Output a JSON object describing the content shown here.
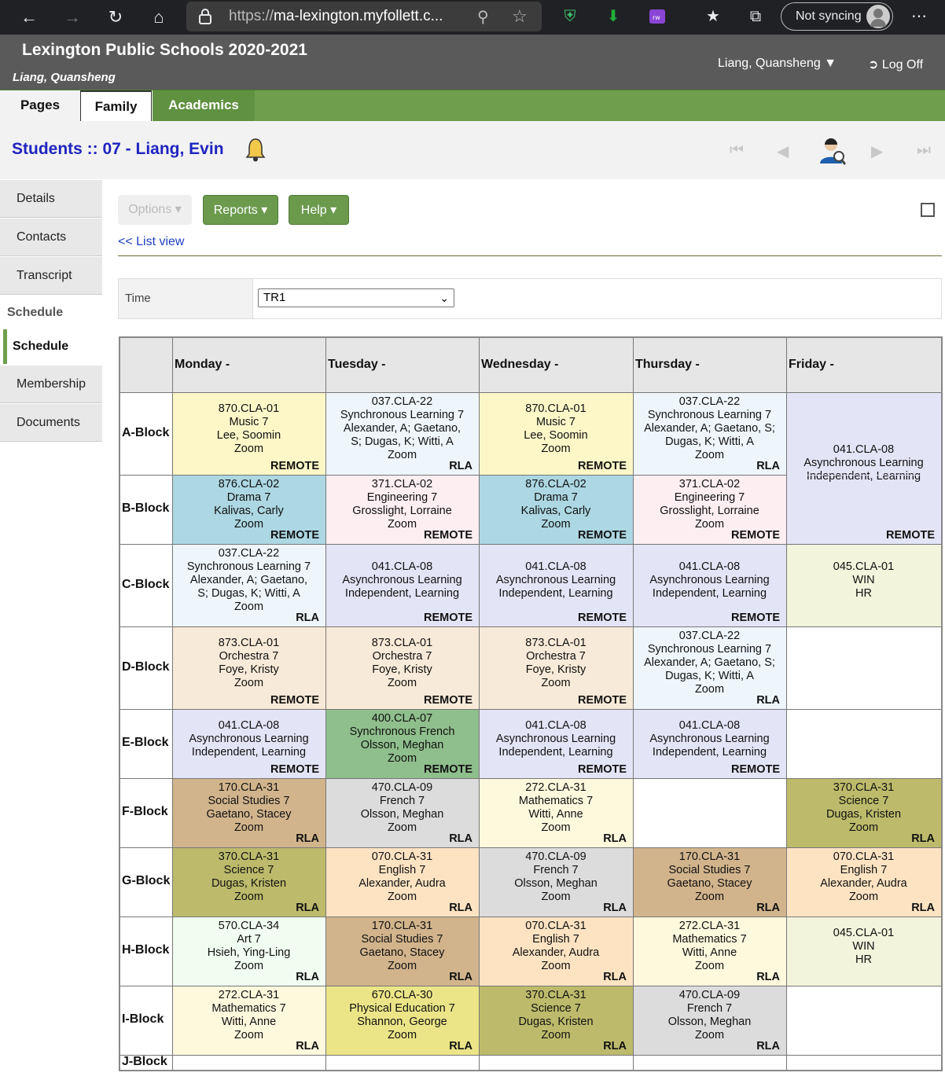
{
  "browser": {
    "url_scheme": "https://",
    "url_host": "ma-lexington.myfollett.c...",
    "sync_label": "Not syncing"
  },
  "header": {
    "school": "Lexington Public Schools 2020-2021",
    "user_italic": "Liang, Quansheng",
    "user_menu": "Liang, Quansheng ▼",
    "logoff": "Log Off"
  },
  "tabs": [
    "Pages",
    "Family",
    "Academics"
  ],
  "title": "Students :: 07 - Liang, Evin",
  "sidenav": {
    "items_top": [
      "Details",
      "Contacts",
      "Transcript"
    ],
    "section": "Schedule",
    "active": "Schedule",
    "items_bottom": [
      "Membership",
      "Documents"
    ]
  },
  "toolbar": {
    "options": "Options",
    "reports": "Reports",
    "help": "Help"
  },
  "list_view": "<< List view",
  "time": {
    "label": "Time",
    "value": "TR1"
  },
  "schedule": {
    "days": [
      "Monday -",
      "Tuesday -",
      "Wednesday -",
      "Thursday -",
      "Friday -"
    ],
    "blocks": [
      "A-Block",
      "B-Block",
      "C-Block",
      "D-Block",
      "E-Block",
      "F-Block",
      "G-Block",
      "H-Block",
      "I-Block",
      "J-Block"
    ],
    "cells": [
      {
        "b": 0,
        "d": 0,
        "lines": [
          "870.CLA-01",
          "Music 7",
          "Lee, Soomin",
          "Zoom"
        ],
        "tag": "REMOTE",
        "color": "#fdf7c8"
      },
      {
        "b": 0,
        "d": 1,
        "lines": [
          "037.CLA-22",
          "Synchronous Learning 7",
          "Alexander, A; Gaetano,",
          "S; Dugas, K; Witti, A",
          "Zoom"
        ],
        "tag": "RLA",
        "color": "#eef6fc"
      },
      {
        "b": 0,
        "d": 2,
        "lines": [
          "870.CLA-01",
          "Music 7",
          "Lee, Soomin",
          "Zoom"
        ],
        "tag": "REMOTE",
        "color": "#fdf7c8"
      },
      {
        "b": 0,
        "d": 3,
        "lines": [
          "037.CLA-22",
          "Synchronous Learning 7",
          "Alexander, A; Gaetano, S;",
          "Dugas, K; Witti, A",
          "Zoom"
        ],
        "tag": "RLA",
        "color": "#eef6fc"
      },
      {
        "b": 0,
        "d": 4,
        "span": 2,
        "lines": [
          "041.CLA-08",
          "Asynchronous Learning",
          "Independent, Learning"
        ],
        "tag": "REMOTE",
        "color": "#e4e4f7"
      },
      {
        "b": 1,
        "d": 0,
        "lines": [
          "876.CLA-02",
          "Drama 7",
          "Kalivas, Carly",
          "Zoom"
        ],
        "tag": "REMOTE",
        "color": "#acd7e3"
      },
      {
        "b": 1,
        "d": 1,
        "lines": [
          "371.CLA-02",
          "Engineering 7",
          "Grosslight, Lorraine",
          "Zoom"
        ],
        "tag": "REMOTE",
        "color": "#fdeef2"
      },
      {
        "b": 1,
        "d": 2,
        "lines": [
          "876.CLA-02",
          "Drama 7",
          "Kalivas, Carly",
          "Zoom"
        ],
        "tag": "REMOTE",
        "color": "#acd7e3"
      },
      {
        "b": 1,
        "d": 3,
        "lines": [
          "371.CLA-02",
          "Engineering 7",
          "Grosslight, Lorraine",
          "Zoom"
        ],
        "tag": "REMOTE",
        "color": "#fdeef2"
      },
      {
        "b": 2,
        "d": 0,
        "lines": [
          "037.CLA-22",
          "Synchronous Learning 7",
          "Alexander, A; Gaetano,",
          "S; Dugas, K; Witti, A",
          "Zoom"
        ],
        "tag": "RLA",
        "color": "#eef6fc"
      },
      {
        "b": 2,
        "d": 1,
        "lines": [
          "041.CLA-08",
          "Asynchronous Learning",
          "Independent, Learning"
        ],
        "tag": "REMOTE",
        "color": "#e4e4f7"
      },
      {
        "b": 2,
        "d": 2,
        "lines": [
          "041.CLA-08",
          "Asynchronous Learning",
          "Independent, Learning"
        ],
        "tag": "REMOTE",
        "color": "#e4e4f7"
      },
      {
        "b": 2,
        "d": 3,
        "lines": [
          "041.CLA-08",
          "Asynchronous Learning",
          "Independent, Learning"
        ],
        "tag": "REMOTE",
        "color": "#e4e4f7"
      },
      {
        "b": 2,
        "d": 4,
        "lines": [
          "045.CLA-01",
          "WIN",
          "HR"
        ],
        "tag": "",
        "color": "#f3f4dc"
      },
      {
        "b": 3,
        "d": 0,
        "lines": [
          "873.CLA-01",
          "Orchestra 7",
          "Foye, Kristy",
          "Zoom"
        ],
        "tag": "REMOTE",
        "color": "#f8ead8"
      },
      {
        "b": 3,
        "d": 1,
        "lines": [
          "873.CLA-01",
          "Orchestra 7",
          "Foye, Kristy",
          "Zoom"
        ],
        "tag": "REMOTE",
        "color": "#f8ead8"
      },
      {
        "b": 3,
        "d": 2,
        "lines": [
          "873.CLA-01",
          "Orchestra 7",
          "Foye, Kristy",
          "Zoom"
        ],
        "tag": "REMOTE",
        "color": "#f8ead8"
      },
      {
        "b": 3,
        "d": 3,
        "lines": [
          "037.CLA-22",
          "Synchronous Learning 7",
          "Alexander, A; Gaetano, S;",
          "Dugas, K; Witti, A",
          "Zoom"
        ],
        "tag": "RLA",
        "color": "#eef6fc"
      },
      {
        "b": 4,
        "d": 0,
        "lines": [
          "041.CLA-08",
          "Asynchronous Learning",
          "Independent, Learning"
        ],
        "tag": "REMOTE",
        "color": "#e4e4f7"
      },
      {
        "b": 4,
        "d": 1,
        "lines": [
          "400.CLA-07",
          "Synchronous French",
          "Olsson, Meghan",
          "Zoom"
        ],
        "tag": "REMOTE",
        "color": "#8fbf8c"
      },
      {
        "b": 4,
        "d": 2,
        "lines": [
          "041.CLA-08",
          "Asynchronous Learning",
          "Independent, Learning"
        ],
        "tag": "REMOTE",
        "color": "#e4e4f7"
      },
      {
        "b": 4,
        "d": 3,
        "lines": [
          "041.CLA-08",
          "Asynchronous Learning",
          "Independent, Learning"
        ],
        "tag": "REMOTE",
        "color": "#e4e4f7"
      },
      {
        "b": 5,
        "d": 0,
        "lines": [
          "170.CLA-31",
          "Social Studies 7",
          "Gaetano, Stacey",
          "Zoom"
        ],
        "tag": "RLA",
        "color": "#d2b48c"
      },
      {
        "b": 5,
        "d": 1,
        "lines": [
          "470.CLA-09",
          "French 7",
          "Olsson, Meghan",
          "Zoom"
        ],
        "tag": "RLA",
        "color": "#dcdcdc"
      },
      {
        "b": 5,
        "d": 2,
        "lines": [
          "272.CLA-31",
          "Mathematics 7",
          "Witti, Anne",
          "Zoom"
        ],
        "tag": "RLA",
        "color": "#fef8dd"
      },
      {
        "b": 5,
        "d": 4,
        "lines": [
          "370.CLA-31",
          "Science 7",
          "Dugas, Kristen",
          "Zoom"
        ],
        "tag": "RLA",
        "color": "#bdbb6b"
      },
      {
        "b": 6,
        "d": 0,
        "lines": [
          "370.CLA-31",
          "Science 7",
          "Dugas, Kristen",
          "Zoom"
        ],
        "tag": "RLA",
        "color": "#bdbb6b"
      },
      {
        "b": 6,
        "d": 1,
        "lines": [
          "070.CLA-31",
          "English 7",
          "Alexander, Audra",
          "Zoom"
        ],
        "tag": "RLA",
        "color": "#fde3c2"
      },
      {
        "b": 6,
        "d": 2,
        "lines": [
          "470.CLA-09",
          "French 7",
          "Olsson, Meghan",
          "Zoom"
        ],
        "tag": "RLA",
        "color": "#dcdcdc"
      },
      {
        "b": 6,
        "d": 3,
        "lines": [
          "170.CLA-31",
          "Social Studies 7",
          "Gaetano, Stacey",
          "Zoom"
        ],
        "tag": "RLA",
        "color": "#d2b48c"
      },
      {
        "b": 6,
        "d": 4,
        "lines": [
          "070.CLA-31",
          "English 7",
          "Alexander, Audra",
          "Zoom"
        ],
        "tag": "RLA",
        "color": "#fde3c2"
      },
      {
        "b": 7,
        "d": 0,
        "lines": [
          "570.CLA-34",
          "Art 7",
          "Hsieh, Ying-Ling",
          "Zoom"
        ],
        "tag": "RLA",
        "color": "#f1fdf0"
      },
      {
        "b": 7,
        "d": 1,
        "lines": [
          "170.CLA-31",
          "Social Studies 7",
          "Gaetano, Stacey",
          "Zoom"
        ],
        "tag": "RLA",
        "color": "#d2b48c"
      },
      {
        "b": 7,
        "d": 2,
        "lines": [
          "070.CLA-31",
          "English 7",
          "Alexander, Audra",
          "Zoom"
        ],
        "tag": "RLA",
        "color": "#fde3c2"
      },
      {
        "b": 7,
        "d": 3,
        "lines": [
          "272.CLA-31",
          "Mathematics 7",
          "Witti, Anne",
          "Zoom"
        ],
        "tag": "RLA",
        "color": "#fef8dd"
      },
      {
        "b": 7,
        "d": 4,
        "lines": [
          "045.CLA-01",
          "WIN",
          "HR"
        ],
        "tag": "",
        "color": "#f3f4dc"
      },
      {
        "b": 8,
        "d": 0,
        "lines": [
          "272.CLA-31",
          "Mathematics 7",
          "Witti, Anne",
          "Zoom"
        ],
        "tag": "RLA",
        "color": "#fef8dd"
      },
      {
        "b": 8,
        "d": 1,
        "lines": [
          "670.CLA-30",
          "Physical Education 7",
          "Shannon, George",
          "Zoom"
        ],
        "tag": "RLA",
        "color": "#ece588"
      },
      {
        "b": 8,
        "d": 2,
        "lines": [
          "370.CLA-31",
          "Science 7",
          "Dugas, Kristen",
          "Zoom"
        ],
        "tag": "RLA",
        "color": "#bdbb6b"
      },
      {
        "b": 8,
        "d": 3,
        "lines": [
          "470.CLA-09",
          "French 7",
          "Olsson, Meghan",
          "Zoom"
        ],
        "tag": "RLA",
        "color": "#dcdcdc"
      }
    ]
  }
}
